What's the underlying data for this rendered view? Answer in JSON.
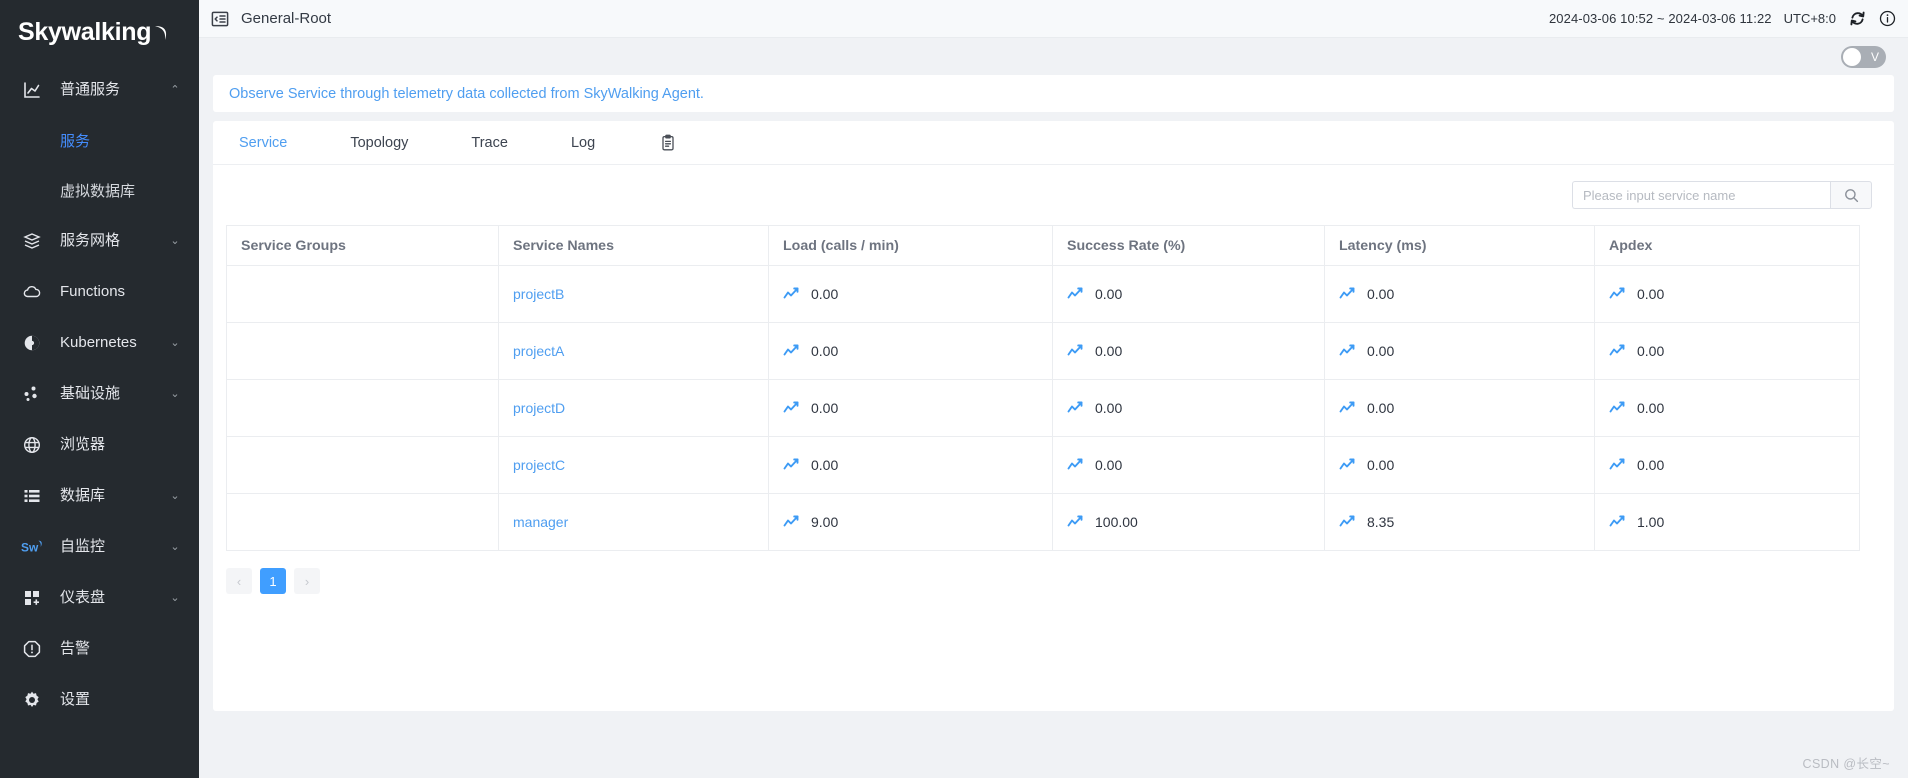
{
  "brand": {
    "name": "Skywalking",
    "moon_icon": "crescent-moon-icon"
  },
  "sidebar": {
    "items": [
      {
        "id": "general-service",
        "label": "普通服务",
        "icon": "chart-bar-icon",
        "expandable": true,
        "expanded": true,
        "caret": "⌃"
      },
      {
        "id": "virtual-database",
        "label": "虚拟数据库",
        "icon": null,
        "sub": true
      },
      {
        "id": "service-mesh",
        "label": "服务网格",
        "icon": "mesh-layers-icon",
        "expandable": true,
        "expanded": false,
        "caret": "⌄"
      },
      {
        "id": "functions",
        "label": "Functions",
        "icon": "cloud-icon",
        "expandable": false
      },
      {
        "id": "kubernetes",
        "label": "Kubernetes",
        "icon": "kubernetes-pie-icon",
        "expandable": true,
        "expanded": false,
        "caret": "⌄"
      },
      {
        "id": "infrastructure",
        "label": "基础设施",
        "icon": "nodes-icon",
        "expandable": true,
        "expanded": false,
        "caret": "⌄"
      },
      {
        "id": "browser",
        "label": "浏览器",
        "icon": "globe-icon",
        "expandable": false
      },
      {
        "id": "database",
        "label": "数据库",
        "icon": "list-rows-icon",
        "expandable": true,
        "expanded": false,
        "caret": "⌄"
      },
      {
        "id": "self-monitoring",
        "label": "自监控",
        "icon": "skywalking-sw-icon",
        "expandable": true,
        "expanded": false,
        "caret": "⌄"
      },
      {
        "id": "dashboard",
        "label": "仪表盘",
        "icon": "grid-plus-icon",
        "expandable": true,
        "expanded": false,
        "caret": "⌄"
      },
      {
        "id": "alarm",
        "label": "告警",
        "icon": "alert-octagon-icon",
        "expandable": false
      },
      {
        "id": "settings",
        "label": "设置",
        "icon": "gear-icon",
        "expandable": false
      }
    ],
    "sub_items": [
      {
        "id": "service",
        "label": "服务",
        "active": true
      },
      {
        "id": "virtual-database",
        "label": "虚拟数据库",
        "active": false
      }
    ]
  },
  "topbar": {
    "collapse_icon": "collapse-sidebar-icon",
    "title": "General-Root",
    "time_range": "2024-03-06 10:52 ~ 2024-03-06 11:22",
    "timezone": "UTC+8:0",
    "refresh_icon": "refresh-icon",
    "info_icon": "info-circle-icon"
  },
  "toolbar": {
    "toggle_label": "V",
    "toggle_on": false
  },
  "banner": {
    "text": "Observe Service through telemetry data collected from SkyWalking Agent."
  },
  "tabs": [
    {
      "id": "service",
      "label": "Service",
      "active": true
    },
    {
      "id": "topology",
      "label": "Topology",
      "active": false
    },
    {
      "id": "trace",
      "label": "Trace",
      "active": false
    },
    {
      "id": "log",
      "label": "Log",
      "active": false
    }
  ],
  "tab_action_icon": "clipboard-icon",
  "search": {
    "placeholder": "Please input service name",
    "value": "",
    "button_icon": "search-icon"
  },
  "table": {
    "columns": [
      "Service Groups",
      "Service Names",
      "Load (calls / min)",
      "Success Rate (%)",
      "Latency (ms)",
      "Apdex"
    ],
    "rows": [
      {
        "group": "",
        "name": "projectB",
        "load": "0.00",
        "success_rate": "0.00",
        "latency": "0.00",
        "apdex": "0.00"
      },
      {
        "group": "",
        "name": "projectA",
        "load": "0.00",
        "success_rate": "0.00",
        "latency": "0.00",
        "apdex": "0.00"
      },
      {
        "group": "",
        "name": "projectD",
        "load": "0.00",
        "success_rate": "0.00",
        "latency": "0.00",
        "apdex": "0.00"
      },
      {
        "group": "",
        "name": "projectC",
        "load": "0.00",
        "success_rate": "0.00",
        "latency": "0.00",
        "apdex": "0.00"
      },
      {
        "group": "",
        "name": "manager",
        "load": "9.00",
        "success_rate": "100.00",
        "latency": "8.35",
        "apdex": "1.00"
      }
    ]
  },
  "pagination": {
    "prev_label": "‹",
    "pages": [
      "1"
    ],
    "current": "1",
    "next_label": "›"
  },
  "watermark": "CSDN @长空~",
  "colors": {
    "sidebar_bg": "#252a2f",
    "accent": "#4f9ef0",
    "pager_active": "#409eff",
    "trend": "#3d9bf5"
  }
}
